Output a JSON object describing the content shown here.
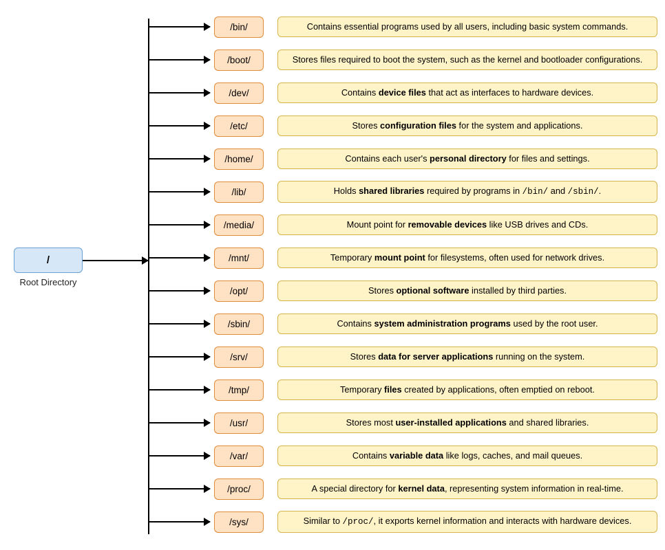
{
  "root": {
    "symbol": "/",
    "label": "Root Directory"
  },
  "directories": [
    {
      "name": "/bin/",
      "desc": "Contains essential programs used by all users, including basic system commands."
    },
    {
      "name": "/boot/",
      "desc": "Stores files required to boot the system, such as the kernel and bootloader configurations."
    },
    {
      "name": "/dev/",
      "desc": "Contains <b>device files</b> that act as interfaces to hardware devices."
    },
    {
      "name": "/etc/",
      "desc": "Stores <b>configuration files</b> for the system and applications."
    },
    {
      "name": "/home/",
      "desc": "Contains each user's <b>personal directory</b> for files and settings."
    },
    {
      "name": "/lib/",
      "desc": "Holds <b>shared libraries</b> required by programs in <code>/bin/</code> and <code>/sbin/</code>."
    },
    {
      "name": "/media/",
      "desc": "Mount point for <b>removable devices</b> like USB drives and CDs."
    },
    {
      "name": "/mnt/",
      "desc": "Temporary <b>mount point</b> for filesystems, often used for network drives."
    },
    {
      "name": "/opt/",
      "desc": "Stores <b>optional software</b> installed by third parties."
    },
    {
      "name": "/sbin/",
      "desc": "Contains <b>system administration programs</b> used by the root user."
    },
    {
      "name": "/srv/",
      "desc": "Stores <b>data for server applications</b> running on the system."
    },
    {
      "name": "/tmp/",
      "desc": "Temporary <b>files</b> created by applications, often emptied on reboot."
    },
    {
      "name": "/usr/",
      "desc": "Stores most <b>user-installed applications</b> and shared libraries."
    },
    {
      "name": "/var/",
      "desc": "Contains <b>variable data</b> like logs, caches, and mail queues."
    },
    {
      "name": "/proc/",
      "desc": "A special directory for <b>kernel data</b>, representing system information in real-time."
    },
    {
      "name": "/sys/",
      "desc": "Similar to <code>/proc/</code>, it exports kernel information and interacts with hardware devices."
    }
  ]
}
